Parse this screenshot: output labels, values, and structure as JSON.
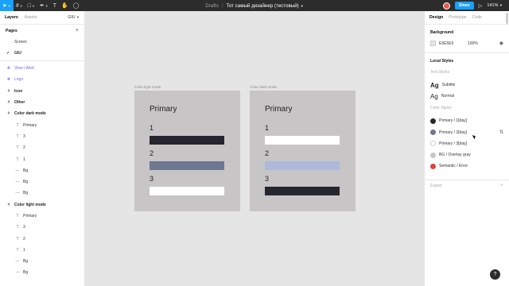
{
  "toolbar": {
    "tools": [
      {
        "icon": "move-icon",
        "glyph": "➤",
        "active": true
      },
      {
        "icon": "hash-frame-icon",
        "glyph": "#"
      },
      {
        "icon": "rectangle-icon",
        "glyph": "□"
      },
      {
        "icon": "pen-icon",
        "glyph": "✒"
      },
      {
        "icon": "text-icon",
        "glyph": "T"
      },
      {
        "icon": "hand-icon",
        "glyph": "✋"
      },
      {
        "icon": "comment-icon",
        "glyph": "◯"
      }
    ],
    "breadcrumb": "Drafts",
    "separator": "/",
    "document_title": "Тот самый дизайнер (тестовый)",
    "share_label": "Share",
    "zoom": "141%"
  },
  "left_panel": {
    "tabs": {
      "layers": "Layers",
      "assets": "Assets",
      "page_selector": "GIU"
    },
    "pages_title": "Pages",
    "pages": [
      {
        "label": "Screen",
        "current": false
      },
      {
        "label": "GIU",
        "current": true
      }
    ],
    "layers": [
      {
        "label": "View / Alert",
        "kind": "component",
        "level": 0,
        "icon": "✥"
      },
      {
        "label": "Logo",
        "kind": "component",
        "level": 0,
        "icon": "✥"
      },
      {
        "label": "Icon",
        "kind": "frame",
        "level": 0,
        "icon": "#"
      },
      {
        "label": "Other",
        "kind": "frame",
        "level": 0,
        "icon": "#"
      },
      {
        "label": "Color dark mode",
        "kind": "frame",
        "level": 0,
        "icon": "#"
      },
      {
        "label": "Primary",
        "kind": "text",
        "level": 1,
        "icon": "T"
      },
      {
        "label": "3",
        "kind": "text",
        "level": 1,
        "icon": "T"
      },
      {
        "label": "2",
        "kind": "text",
        "level": 1,
        "icon": "T"
      },
      {
        "label": "1",
        "kind": "text",
        "level": 1,
        "icon": "T"
      },
      {
        "label": "Bg",
        "kind": "rect",
        "level": 1,
        "icon": "—"
      },
      {
        "label": "Bg",
        "kind": "rect",
        "level": 1,
        "icon": "—"
      },
      {
        "label": "Bg",
        "kind": "rect",
        "level": 1,
        "icon": "—"
      },
      {
        "label": "Color light mode",
        "kind": "frame",
        "level": 0,
        "icon": "#"
      },
      {
        "label": "Primary",
        "kind": "text",
        "level": 1,
        "icon": "T"
      },
      {
        "label": "3",
        "kind": "text",
        "level": 1,
        "icon": "T"
      },
      {
        "label": "2",
        "kind": "text",
        "level": 1,
        "icon": "T"
      },
      {
        "label": "1",
        "kind": "text",
        "level": 1,
        "icon": "T"
      },
      {
        "label": "Bg",
        "kind": "rect",
        "level": 1,
        "icon": "—"
      },
      {
        "label": "Bg",
        "kind": "rect",
        "level": 1,
        "icon": "—"
      }
    ]
  },
  "canvas": {
    "frames": [
      {
        "label": "Color light mode",
        "title": "Primary",
        "rows": [
          {
            "num": "1",
            "color": "#26262e"
          },
          {
            "num": "2",
            "color": "#6e7690"
          },
          {
            "num": "3",
            "color": "#ffffff"
          }
        ]
      },
      {
        "label": "Color dark mode",
        "title": "Primary",
        "rows": [
          {
            "num": "1",
            "color": "#ffffff"
          },
          {
            "num": "2",
            "color": "#aeb9d8"
          },
          {
            "num": "3",
            "color": "#26262e"
          }
        ]
      }
    ]
  },
  "right_panel": {
    "tabs": {
      "design": "Design",
      "prototype": "Prototype",
      "code": "Code"
    },
    "background_title": "Background",
    "background": {
      "hex": "E5E5E5",
      "opacity": "100%",
      "color": "#e5e5e5"
    },
    "local_styles_title": "Local Styles",
    "text_styles_title": "Text Styles",
    "text_styles": [
      {
        "preview": "Ag",
        "label": "Subtitle"
      },
      {
        "preview": "Ag",
        "label": "Normal"
      }
    ],
    "color_styles_title": "Color Styles",
    "color_styles": [
      {
        "label": "Primary / 1[day]",
        "color": "#26262e"
      },
      {
        "label": "Primary / 2[day]",
        "color": "#6e7690"
      },
      {
        "label": "Primary / 3[day]",
        "color": "#ffffff"
      },
      {
        "label": "BG / Overlay gray",
        "color": "#c7c5c5"
      },
      {
        "label": "Semantic / Error",
        "color": "#d9453d"
      }
    ],
    "export_label": "Export"
  },
  "help": "?"
}
